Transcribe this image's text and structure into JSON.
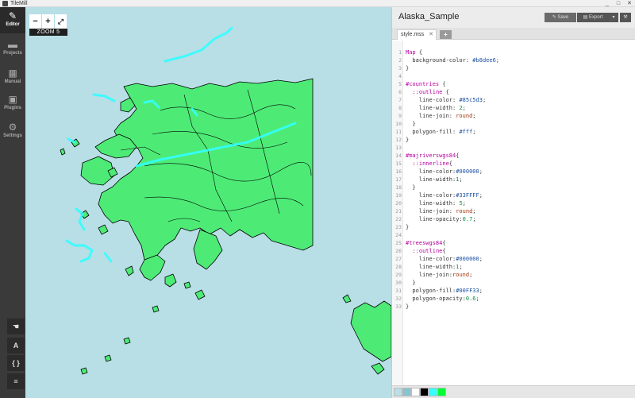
{
  "window": {
    "title": "TileMill",
    "controls": [
      "_",
      "□",
      "✕"
    ]
  },
  "nav": {
    "items": [
      {
        "label": "Editor",
        "icon": "pencil-icon",
        "glyph": "✎",
        "active": true
      },
      {
        "label": "Projects",
        "icon": "folder-icon",
        "glyph": "▬",
        "active": false
      },
      {
        "label": "Manual",
        "icon": "book-icon",
        "glyph": "▦",
        "active": false
      },
      {
        "label": "Plugins",
        "icon": "plugin-icon",
        "glyph": "▣",
        "active": false
      },
      {
        "label": "Settings",
        "icon": "gear-icon",
        "glyph": "⚙",
        "active": false
      }
    ],
    "tools": [
      {
        "name": "pan-tool-icon",
        "glyph": "☚"
      },
      {
        "name": "font-tool-icon",
        "glyph": "A"
      },
      {
        "name": "code-tool-icon",
        "glyph": "{ }"
      },
      {
        "name": "layers-tool-icon",
        "glyph": "≡"
      }
    ]
  },
  "map": {
    "background": "#b8dee6",
    "zoom_in": "+",
    "zoom_out": "−",
    "fullscreen": "⤢",
    "zoom_label": "ZOOM 5",
    "land_color": "#4deb76",
    "river_color": "#33ffff"
  },
  "editor": {
    "project_title": "Alaska_Sample",
    "save_label": "Save",
    "export_label": "Export",
    "export_caret": "▾",
    "wrench": "🔧",
    "tab_label": "style.mss",
    "tab_close": "✕",
    "add_tab": "+",
    "code_lines": [
      "Map {",
      "  background-color: #b8dee6;",
      "}",
      "",
      "#countries {",
      "  ::outline {",
      "    line-color: #85c5d3;",
      "    line-width: 2;",
      "    line-join: round;",
      "  }",
      "  polygon-fill: #fff;",
      "}",
      "",
      "#majriverswgs84{",
      "  ::innerline{",
      "    line-color:#000000;",
      "    line-width:1;",
      "  }",
      "    line-color:#33FFFF;",
      "    line-width: 5;",
      "    line-join: round;",
      "    line-opacity:0.7;",
      "}",
      "",
      "#treeswgs84{",
      "  ::outline{",
      "    line-color:#000000;",
      "    line-width:1;",
      "    line-join:round;",
      "  }",
      "  polygon-fill:#00FF33;",
      "  polygon-opacity:0.6;",
      "}"
    ],
    "palette": [
      "#b8dee6",
      "#85c5d3",
      "#ffffff",
      "#000000",
      "#33ffff",
      "#00ff33"
    ]
  }
}
